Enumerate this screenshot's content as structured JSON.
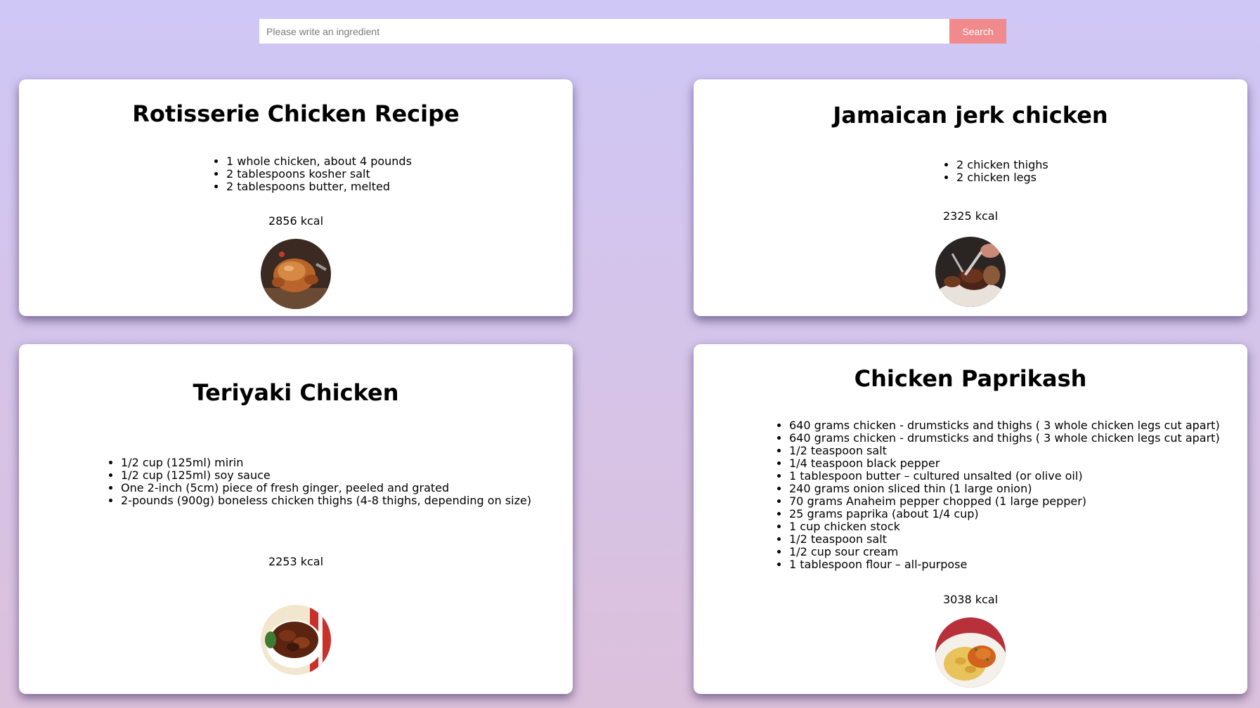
{
  "search": {
    "placeholder": "Please write an ingredient",
    "button_label": "Search"
  },
  "colors": {
    "background_top": "#cfc7f6",
    "background_bottom": "#dcc1dc",
    "search_button": "#f08a8c",
    "card": "#ffffff"
  },
  "recipes": [
    {
      "title": "Rotisserie Chicken Recipe",
      "ingredients": [
        "1 whole chicken, about 4 pounds",
        "2 tablespoons kosher salt",
        "2 tablespoons butter, melted"
      ],
      "kcal": "2856 kcal",
      "image": "rotisserie-chicken-photo"
    },
    {
      "title": "Jamaican jerk chicken",
      "ingredients": [
        "2 chicken thighs",
        "2 chicken legs"
      ],
      "kcal": "2325 kcal",
      "image": "jerk-chicken-photo"
    },
    {
      "title": "Teriyaki Chicken",
      "ingredients": [
        "1/2 cup (125ml) mirin",
        "1/2 cup (125ml) soy sauce",
        "One 2-inch (5cm) piece of fresh ginger, peeled and grated",
        "2-pounds (900g) boneless chicken thighs (4-8 thighs, depending on size)"
      ],
      "kcal": "2253 kcal",
      "image": "teriyaki-chicken-photo"
    },
    {
      "title": "Chicken Paprikash",
      "ingredients": [
        "640 grams chicken - drumsticks and thighs ( 3 whole chicken legs cut apart)",
        "640 grams chicken - drumsticks and thighs ( 3 whole chicken legs cut apart)",
        "1/2 teaspoon salt",
        "1/4 teaspoon black pepper",
        "1 tablespoon butter – cultured unsalted (or olive oil)",
        "240 grams onion sliced thin (1 large onion)",
        "70 grams Anaheim pepper chopped (1 large pepper)",
        "25 grams paprika (about 1/4 cup)",
        "1 cup chicken stock",
        "1/2 teaspoon salt",
        "1/2 cup sour cream",
        "1 tablespoon flour – all-purpose"
      ],
      "kcal": "3038 kcal",
      "image": "chicken-paprikash-photo"
    }
  ]
}
